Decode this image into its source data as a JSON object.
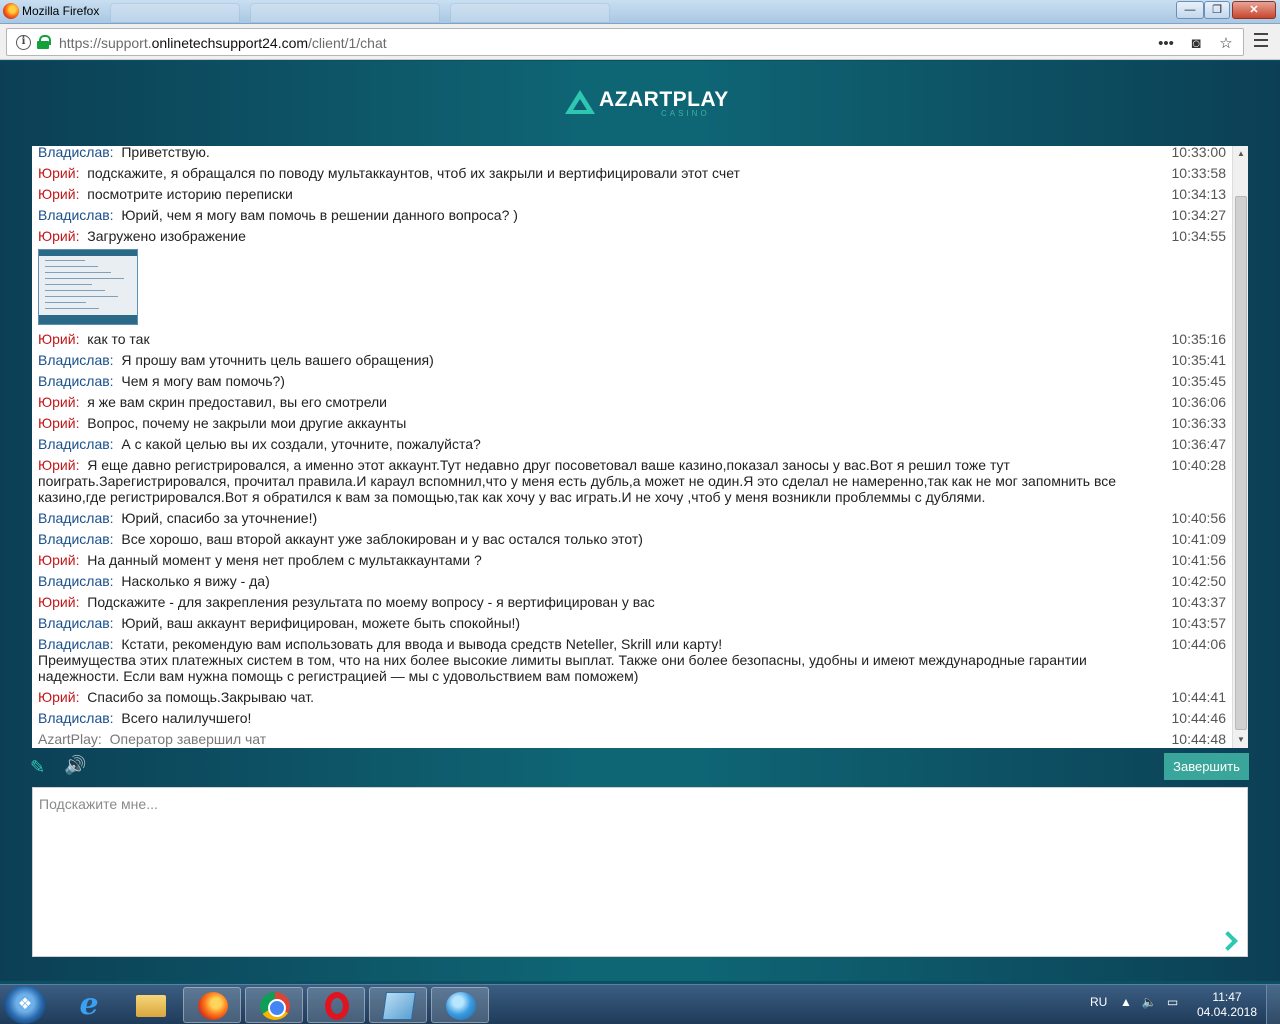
{
  "window": {
    "title": "Mozilla Firefox",
    "min": "—",
    "max": "❐",
    "close": "✕"
  },
  "browser": {
    "url_prefix": "https://support.",
    "url_domain": "onlinetechsupport24.com",
    "url_path": "/client/1/chat"
  },
  "logo": {
    "main": "AZARTPLAY",
    "sub": "CASINO"
  },
  "chat": {
    "messages": [
      {
        "author": "Владислав:",
        "role": "op",
        "text": "Приветствую.",
        "time": "10:33:00"
      },
      {
        "author": "Юрий:",
        "role": "user",
        "text": "подскажите, я обращался по поводу мультаккаунтов, чтоб их закрыли и вертифицировали этот счет",
        "time": "10:33:58"
      },
      {
        "author": "Юрий:",
        "role": "user",
        "text": "посмотрите историю переписки",
        "time": "10:34:13"
      },
      {
        "author": "Владислав:",
        "role": "op",
        "text": "Юрий, чем я могу вам помочь в решении данного вопроса? )",
        "time": "10:34:27"
      },
      {
        "author": "Юрий:",
        "role": "user",
        "text": "Загружено изображение",
        "time": "10:34:55",
        "image": true
      },
      {
        "author": "Юрий:",
        "role": "user",
        "text": "как то так",
        "time": "10:35:16"
      },
      {
        "author": "Владислав:",
        "role": "op",
        "text": "Я прошу вам уточнить цель вашего обращения)",
        "time": "10:35:41"
      },
      {
        "author": "Владислав:",
        "role": "op",
        "text": "Чем я могу вам помочь?)",
        "time": "10:35:45"
      },
      {
        "author": "Юрий:",
        "role": "user",
        "text": "я же вам скрин предоставил, вы его смотрели",
        "time": "10:36:06"
      },
      {
        "author": "Юрий:",
        "role": "user",
        "text": "Вопрос, почему не закрыли мои другие аккаунты",
        "time": "10:36:33"
      },
      {
        "author": "Владислав:",
        "role": "op",
        "text": "А с какой целью вы их создали, уточните, пожалуйста?",
        "time": "10:36:47"
      },
      {
        "author": "Юрий:",
        "role": "user",
        "text": "Я еще давно регистрировался, а именно этот аккаунт.Тут недавно друг посоветовал ваше казино,показал заносы у вас.Вот я решил тоже тут поиграть.Зарегистрировался, прочитал правила.И караул вспомнил,что у меня есть дубль,а может не один.Я это сделал не намеренно,так как не мог запомнить все казино,где регистрировался.Вот я обратился к вам за помощью,так как хочу у вас играть.И не хочу ,чтоб у меня возникли проблеммы с дублями.",
        "time": "10:40:28"
      },
      {
        "author": "Владислав:",
        "role": "op",
        "text": "Юрий, спасибо за уточнение!)",
        "time": "10:40:56"
      },
      {
        "author": "Владислав:",
        "role": "op",
        "text": "Все хорошо, ваш второй аккаунт уже заблокирован и у вас остался только этот)",
        "time": "10:41:09"
      },
      {
        "author": "Юрий:",
        "role": "user",
        "text": "На данный момент у меня нет проблем с мультаккаунтами ?",
        "time": "10:41:56"
      },
      {
        "author": "Владислав:",
        "role": "op",
        "text": "Насколько я вижу - да)",
        "time": "10:42:50"
      },
      {
        "author": "Юрий:",
        "role": "user",
        "text": "Подскажите - для закрепления результата по моему вопросу - я вертифицирован у вас",
        "time": "10:43:37"
      },
      {
        "author": "Владислав:",
        "role": "op",
        "text": "Юрий, ваш аккаунт верифицирован, можете быть спокойны!)",
        "time": "10:43:57"
      },
      {
        "author": "Владислав:",
        "role": "op",
        "text": "Кстати, рекомендую вам использовать для ввода и вывода средств Neteller, Skrill или карту!\nПреимущества этих платежных систем в том, что на них более высокие лимиты выплат. Также они более безопасны, удобны и имеют международные гарантии надежности. Если вам нужна помощь с регистрацией — мы с удовольствием вам поможем)",
        "time": "10:44:06"
      },
      {
        "author": "Юрий:",
        "role": "user",
        "text": "Спасибо за помощь.Закрываю чат.",
        "time": "10:44:41"
      },
      {
        "author": "Владислав:",
        "role": "op",
        "text": "Всего налилучшего!",
        "time": "10:44:46"
      },
      {
        "author": "AzartPlay:",
        "role": "sys",
        "text": "Оператор завершил чат",
        "time": "10:44:48"
      }
    ],
    "end_button": "Завершить",
    "input_placeholder": "Подскажите мне..."
  },
  "taskbar": {
    "lang": "RU",
    "time": "11:47",
    "date": "04.04.2018"
  },
  "colors": {
    "accent": "#2ec7b2",
    "operator": "#1a4f8a",
    "user": "#c0181a",
    "page_bg": "#0e6574"
  }
}
